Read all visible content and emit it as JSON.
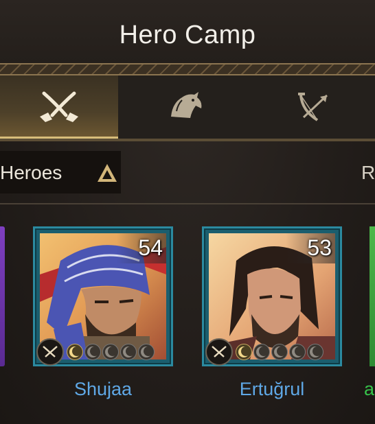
{
  "header": {
    "title": "Hero Camp"
  },
  "tabs": [
    {
      "icon": "crossed-swords-icon",
      "active": true
    },
    {
      "icon": "horse-head-icon",
      "active": false
    },
    {
      "icon": "bow-arrow-icon",
      "active": false
    }
  ],
  "filter": {
    "label": "Heroes",
    "sort_icon": "sort-up-icon",
    "right_partial_label": "R"
  },
  "heroes": [
    {
      "name": "Shujaa",
      "level": "54",
      "stars_lit": 1,
      "stars_total": 5,
      "frame_color": "#2b8aa0",
      "name_color": "#5fa8e6"
    },
    {
      "name": "Ertuğrul",
      "level": "53",
      "stars_lit": 1,
      "stars_total": 5,
      "frame_color": "#2b8aa0",
      "name_color": "#5fa8e6"
    }
  ],
  "partial_right_name": "a",
  "colors": {
    "accent_gold": "#d8bd7a",
    "rare_purple": "#7e3fc0",
    "uncommon_green": "#36c24a"
  }
}
